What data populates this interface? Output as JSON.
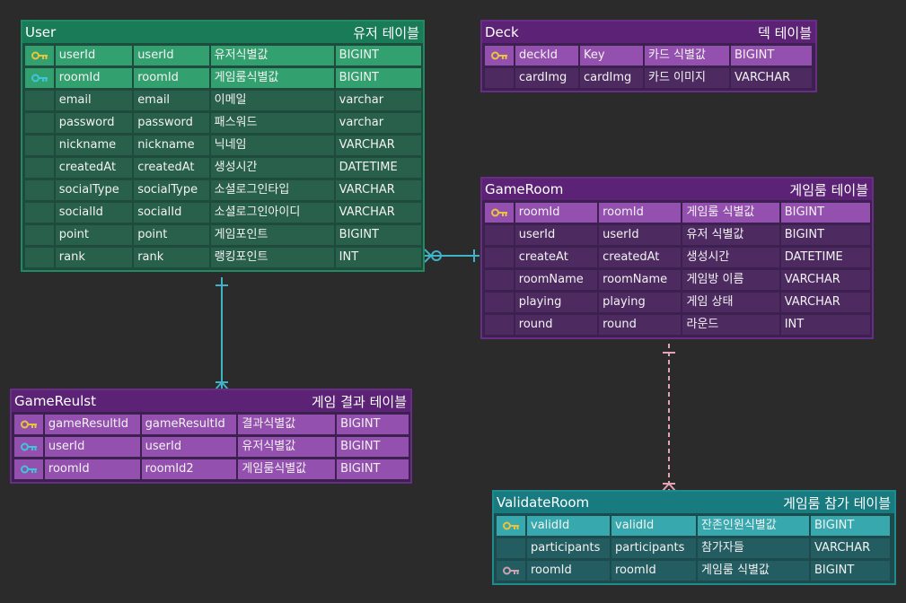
{
  "colors": {
    "link": "#3fb3c8",
    "link_dashed": "#e2a3b4",
    "key_primary": "#e7c43b",
    "key_foreign": "#3ec6d8",
    "key_inactive": "#c7a3b0"
  },
  "tables": [
    {
      "id": "user",
      "name": "User",
      "label": "유저 테이블",
      "theme": {
        "border": "#1f8a63",
        "header": "#197b57",
        "body": "#1e4b3d",
        "cell": "#28604c",
        "pk": "#33a06f"
      },
      "columns": [
        {
          "key": "key-primary",
          "values": [
            "userId",
            "userId",
            "유저식별값",
            "BIGINT"
          ],
          "highlight": true
        },
        {
          "key": "key-foreign",
          "values": [
            "roomId",
            "roomId",
            "게임룸식별값",
            "BIGINT"
          ],
          "highlight": true
        },
        {
          "key": "",
          "values": [
            "email",
            "email",
            "이메일",
            "varchar"
          ]
        },
        {
          "key": "",
          "values": [
            "password",
            "password",
            "패스워드",
            "varchar"
          ]
        },
        {
          "key": "",
          "values": [
            "nickname",
            "nickname",
            "닉네임",
            "VARCHAR"
          ]
        },
        {
          "key": "",
          "values": [
            "createdAt",
            "createdAt",
            "생성시간",
            "DATETIME"
          ]
        },
        {
          "key": "",
          "values": [
            "socialType",
            "socialType",
            "소셜로그인타입",
            "VARCHAR"
          ]
        },
        {
          "key": "",
          "values": [
            "socialId",
            "socialId",
            "소셜로그인아이디",
            "VARCHAR"
          ]
        },
        {
          "key": "",
          "values": [
            "point",
            "point",
            "게임포인트",
            "BIGINT"
          ]
        },
        {
          "key": "",
          "values": [
            "rank",
            "rank",
            "랭킹포인트",
            "INT"
          ]
        }
      ]
    },
    {
      "id": "deck",
      "name": "Deck",
      "label": "덱 테이블",
      "theme": {
        "border": "#6a2d86",
        "header": "#5b2275",
        "body": "#3c2150",
        "cell": "#4d2b61",
        "pk": "#9450ae"
      },
      "columns": [
        {
          "key": "key-primary",
          "values": [
            "deckId",
            "Key",
            "카드 식별값",
            "BIGINT"
          ],
          "highlight": true
        },
        {
          "key": "",
          "values": [
            "cardImg",
            "cardImg",
            "카드 이미지",
            "VARCHAR"
          ]
        }
      ]
    },
    {
      "id": "gameroom",
      "name": "GameRoom",
      "label": "게임룸 테이블",
      "theme": {
        "border": "#6a2d86",
        "header": "#5b2275",
        "body": "#3c2150",
        "cell": "#4d2b61",
        "pk": "#9450ae"
      },
      "columns": [
        {
          "key": "key-primary",
          "values": [
            "roomId",
            "roomId",
            "게임룸 식별값",
            "BIGINT"
          ],
          "highlight": true
        },
        {
          "key": "",
          "values": [
            "userId",
            "userId",
            "유저 식별값",
            "BIGINT"
          ]
        },
        {
          "key": "",
          "values": [
            "createAt",
            "createdAt",
            "생성시간",
            "DATETIME"
          ]
        },
        {
          "key": "",
          "values": [
            "roomName",
            "roomName",
            "게임방 이름",
            "VARCHAR"
          ]
        },
        {
          "key": "",
          "values": [
            "playing",
            "playing",
            "게임 상태",
            "VARCHAR"
          ]
        },
        {
          "key": "",
          "values": [
            "round",
            "round",
            "라운드",
            "INT"
          ]
        }
      ]
    },
    {
      "id": "gameresult",
      "name": "GameReulst",
      "label": "게임 결과 테이블",
      "theme": {
        "border": "#6a2d86",
        "header": "#5b2275",
        "body": "#3c2150",
        "cell": "#7a3f96",
        "pk": "#9450ae"
      },
      "columns": [
        {
          "key": "key-primary",
          "values": [
            "gameResultId",
            "gameResultId",
            "결과식별값",
            "BIGINT"
          ],
          "highlight": true
        },
        {
          "key": "key-foreign",
          "values": [
            "userId",
            "userId",
            "유저식별값",
            "BIGINT"
          ],
          "highlight": true
        },
        {
          "key": "key-foreign",
          "values": [
            "roomId",
            "roomId2",
            "게임룸식별값",
            "BIGINT"
          ],
          "highlight": true
        }
      ]
    },
    {
      "id": "validateroom",
      "name": "ValidateRoom",
      "label": "게임룸 참가 테이블",
      "theme": {
        "border": "#1e8b8f",
        "header": "#177b80",
        "body": "#1c4a4d",
        "cell": "#245d61",
        "pk": "#36a8ae"
      },
      "columns": [
        {
          "key": "key-primary",
          "values": [
            "validId",
            "validId",
            "잔존인원식별값",
            "BIGINT"
          ],
          "highlight": true
        },
        {
          "key": "",
          "values": [
            "participants",
            "participants",
            "참가자들",
            "VARCHAR"
          ]
        },
        {
          "key": "key-inactive",
          "values": [
            "roomId",
            "roomId",
            "게임룸 식별값",
            "BIGINT"
          ]
        }
      ]
    }
  ]
}
